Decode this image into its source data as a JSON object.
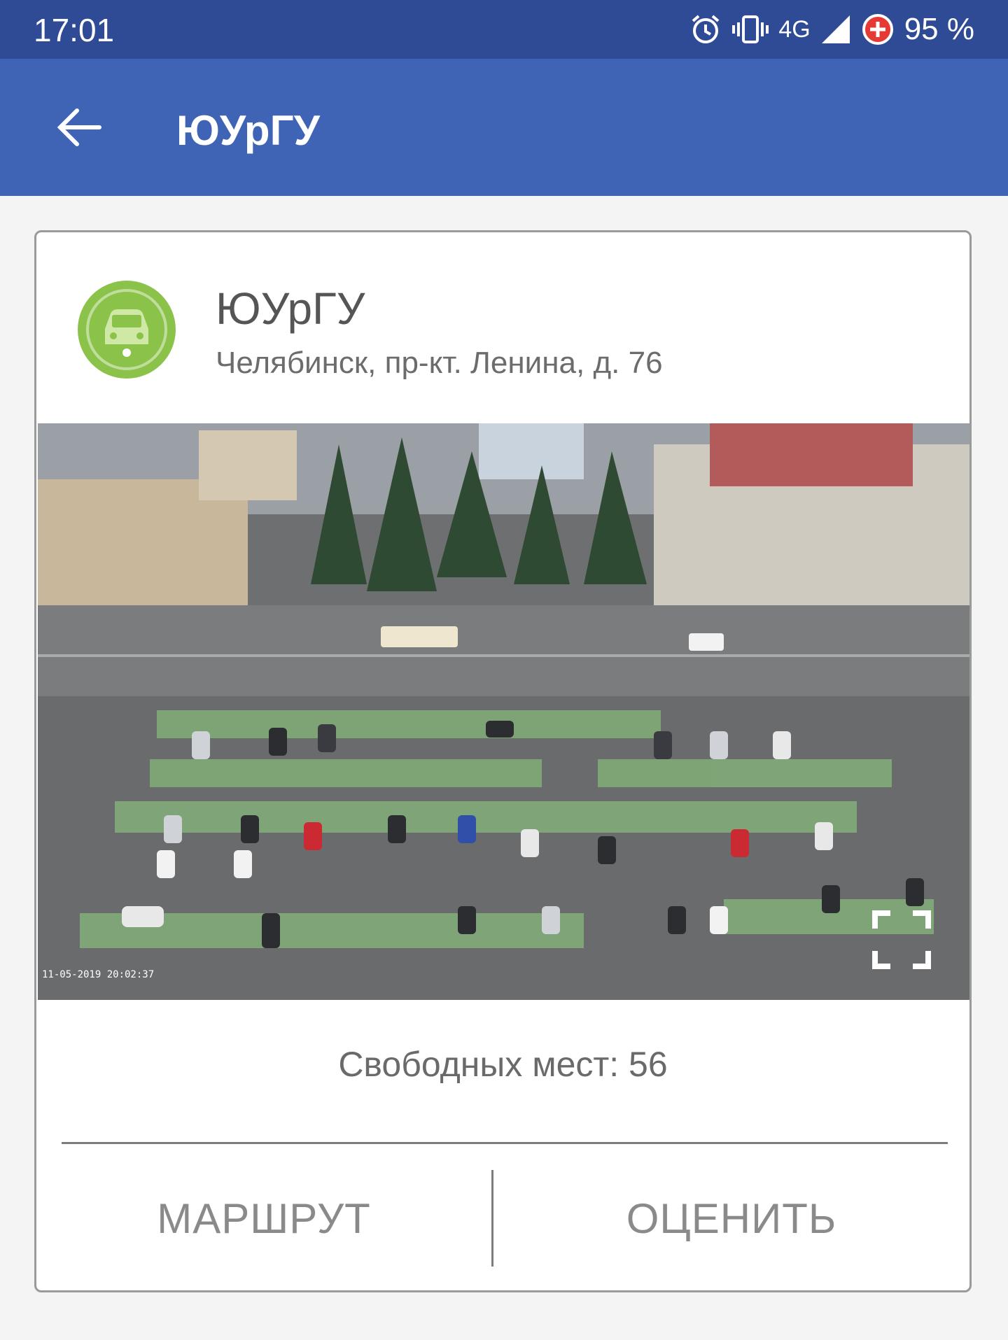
{
  "status_bar": {
    "time": "17:01",
    "network": "4G",
    "battery": "95 %"
  },
  "app_bar": {
    "title": "ЮУрГУ"
  },
  "parking": {
    "name": "ЮУрГУ",
    "address": "Челябинск, пр-кт. Ленина, д. 76",
    "camera_timestamp": "11-05-2019 20:02:37",
    "free_spots_text": "Свободных мест: 56"
  },
  "actions": {
    "route_label": "МАРШРУТ",
    "rate_label": "ОЦЕНИТЬ"
  },
  "colors": {
    "status_bar": "#2f4b96",
    "app_bar": "#3f63b5",
    "logo_green": "#8bc34a"
  },
  "icons": {
    "back": "arrow-left-icon",
    "alarm": "alarm-clock-icon",
    "vibrate": "vibrate-icon",
    "signal": "signal-icon",
    "battery_saver": "battery-saver-icon",
    "parking_logo": "car-logo-icon",
    "fullscreen": "fullscreen-icon"
  }
}
